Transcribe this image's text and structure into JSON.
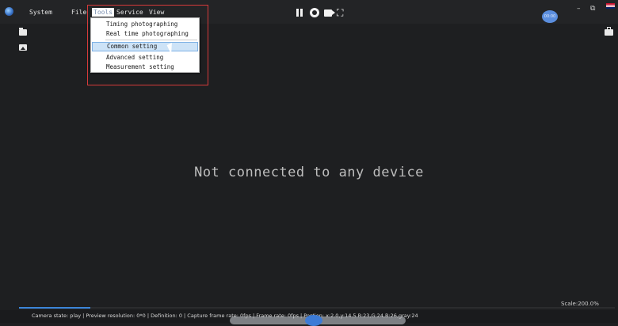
{
  "menubar": {
    "items": [
      "System",
      "File",
      "Tools",
      "Service",
      "View"
    ],
    "active": "Tools"
  },
  "tools_menu": {
    "items": [
      "Timing photographing",
      "Real time photographing",
      "Common setting",
      "Advanced setting",
      "Measurement setting"
    ],
    "hovered": "Common setting"
  },
  "user": {
    "avatar_text": "00:00"
  },
  "window": {
    "minimize": "–",
    "restore": "⧉"
  },
  "main": {
    "message": "Not connected to any device"
  },
  "scale": {
    "label": "Scale:200.0%"
  },
  "progress": {
    "value": 0.12
  },
  "status": {
    "text": "Camera state:  play | Preview resolution:  0*0 | Definition:  0 | Capture frame rate:  0fps | Frame rate:  0fps | Postion:   x:2.0,y:14.5  R:23,G:24,B:26,gray:24"
  },
  "colors": {
    "accent": "#3c86d9",
    "highlight_border": "#d63a3a",
    "background": "#1e1f21"
  },
  "icons": [
    "app-logo-icon",
    "pause-icon",
    "capture-icon",
    "record-icon",
    "fullscreen-icon",
    "folder-icon",
    "image-icon",
    "toolbox-icon",
    "flag-icon"
  ]
}
